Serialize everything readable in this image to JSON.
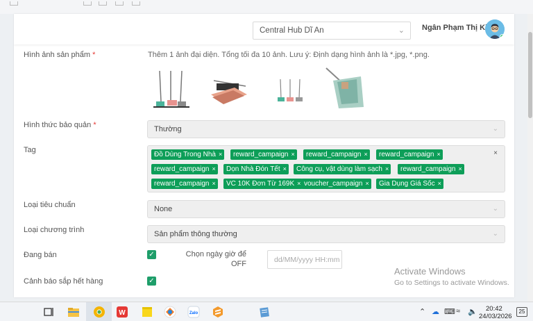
{
  "header": {
    "hub_select": "Central Hub Dĩ An",
    "user_name": "Ngân Phạm Thị Kim"
  },
  "form": {
    "images_label": "Hình ảnh sản phẩm",
    "images_note": "Thêm 1 ảnh đại diện. Tổng tối đa 10 ảnh. Lưu ý: Định dạng hình ảnh là *.jpg, *.png.",
    "storage_label": "Hình thức bảo quản",
    "storage_value": "Thường",
    "tag_label": "Tag",
    "tags": [
      "Đồ Dùng Trong Nhà",
      "reward_campaign",
      "reward_campaign",
      "reward_campaign",
      "reward_campaign",
      "Dọn Nhà Đón Tết",
      "Công cụ, vật dùng làm sạch",
      "reward_campaign",
      "reward_campaign",
      "VC 10K Đơn Từ 169K",
      "voucher_campaign",
      "Gia Dụng Giá Sốc"
    ],
    "standard_label": "Loại tiêu chuẩn",
    "standard_value": "None",
    "program_label": "Loại chương trình",
    "program_value": "Sản phẩm thông thường",
    "selling_label": "Đang bán",
    "selling_checked": true,
    "off_date_label": "Chọn ngày giờ để OFF",
    "off_date_placeholder": "dd/MM/yyyy HH:mm",
    "low_stock_label": "Cảnh báo sắp hết hàng",
    "low_stock_checked": true,
    "required_mark": "*"
  },
  "watermark": {
    "line1": "Activate Windows",
    "line2": "Go to Settings to activate Windows."
  },
  "taskbar": {
    "time": "20:42",
    "date": "24/03/2026",
    "notifications": "25",
    "icons": [
      "task-view-icon",
      "file-explorer-icon",
      "chrome-canary-icon",
      "wps-office-icon",
      "sticky-notes-icon",
      "photos-icon",
      "zalo-icon",
      "sublime-text-icon",
      "notepad-icon"
    ]
  },
  "colors": {
    "tag_green": "#0d9e58",
    "checkbox_green": "#1e9e6a",
    "required_red": "#e53935"
  }
}
